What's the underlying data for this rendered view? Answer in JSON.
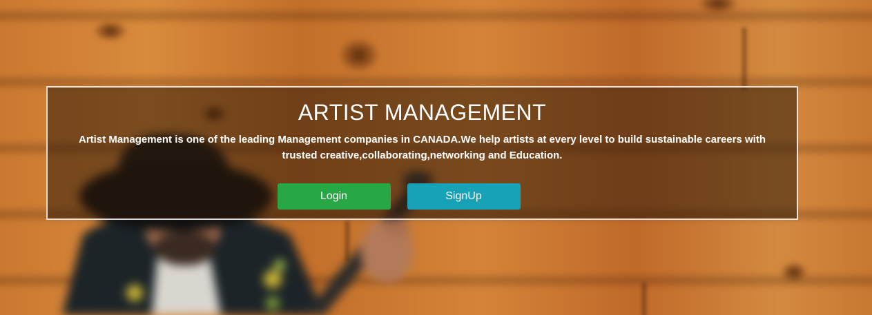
{
  "hero": {
    "title": "ARTIST MANAGEMENT",
    "description": "Artist Management is one of the leading Management companies in CANADA.We help artists at every level to build sustainable careers with trusted creative,collaborating,networking and Education.",
    "login_label": "Login",
    "signup_label": "SignUp"
  },
  "colors": {
    "login_button": "#28a745",
    "signup_button": "#17a2b8",
    "overlay": "rgba(45,25,10,0.55)",
    "wood": "#c9772f"
  }
}
